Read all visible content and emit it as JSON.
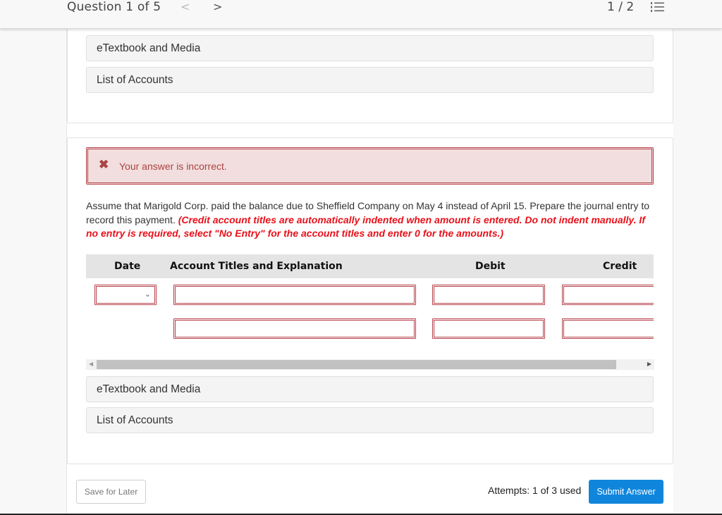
{
  "header": {
    "question_label": "Question 1 of 5",
    "prev_icon": "chevron-left-icon",
    "prev_glyph": "<",
    "next_icon": "chevron-right-icon",
    "next_glyph": ">",
    "page_count": "1 / 2",
    "list_icon": "numbered-list-icon"
  },
  "top_resources": [
    {
      "label": "eTextbook and Media"
    },
    {
      "label": "List of Accounts"
    }
  ],
  "alert": {
    "icon": "x-mark-icon",
    "glyph": "✖",
    "text": "Your answer is incorrect.",
    "color": "#a94442"
  },
  "question": {
    "text": "Assume that Marigold Corp. paid the balance due to Sheffield Company on May 4 instead of April 15. Prepare the journal entry to record this payment. ",
    "instructions": "(Credit account titles are automatically indented when amount is entered. Do not indent manually. If no entry is required, select \"No Entry\" for the account titles and enter 0 for the amounts.)",
    "instruction_color": "#e8101a"
  },
  "journal": {
    "headers": {
      "date": "Date",
      "account": "Account Titles and Explanation",
      "debit": "Debit",
      "credit": "Credit"
    },
    "rows": [
      {
        "date": "",
        "account": "",
        "debit": "",
        "credit": ""
      },
      {
        "account": "",
        "debit": "",
        "credit": ""
      }
    ],
    "date_chevron": "⌄"
  },
  "scrollbar": {
    "left_glyph": "◀",
    "right_glyph": "▶"
  },
  "bottom_resources": [
    {
      "label": "eTextbook and Media"
    },
    {
      "label": "List of Accounts"
    }
  ],
  "footer": {
    "save_label": "Save for Later",
    "attempts_label": "Attempts: 1 of 3 used",
    "submit_label": "Submit Answer",
    "submit_color": "#0f86dc"
  }
}
